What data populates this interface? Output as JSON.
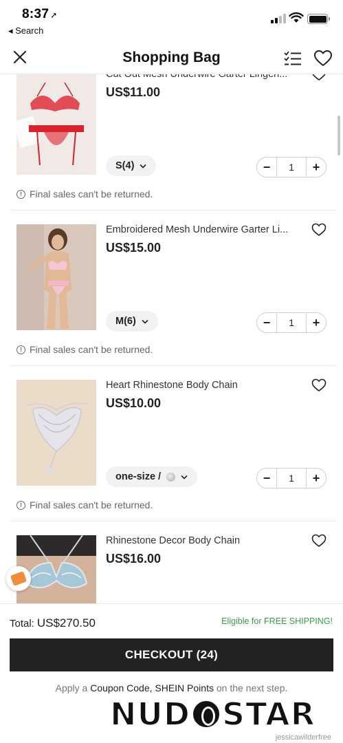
{
  "status_bar": {
    "time": "8:37",
    "back_label": "◂ Search"
  },
  "header": {
    "title": "Shopping Bag"
  },
  "items": [
    {
      "name": "Cut Out Mesh Underwire Garter Lingeri...",
      "price": "US$11.00",
      "size": "S(4)",
      "quantity": "1",
      "notice": "Final sales can't be returned."
    },
    {
      "name": "Embroidered Mesh Underwire Garter Li...",
      "price": "US$15.00",
      "size": "M(6)",
      "quantity": "1",
      "notice": "Final sales can't be returned."
    },
    {
      "name": "Heart Rhinestone Body Chain",
      "price": "US$10.00",
      "size": "one-size /",
      "quantity": "1",
      "notice": "Final sales can't be returned."
    },
    {
      "name": "Rhinestone Decor Body Chain",
      "price": "US$16.00"
    }
  ],
  "footer": {
    "total_label": "Total:",
    "total_value": "US$270.50",
    "free_shipping": "Eligible for FREE SHIPPING!",
    "checkout_label": "CHECKOUT (24)",
    "note_prefix": "Apply a",
    "note_coupon": "Coupon Code, SHEIN Points",
    "note_suffix": "on the next step."
  },
  "watermark": {
    "text_left": "NUD",
    "text_right": "STAR",
    "user": "jessicawilderfree"
  },
  "colors": {
    "checkout_bg": "#222222",
    "free_shipping": "#3a9a4e",
    "accent_orange": "#f08d3a"
  }
}
